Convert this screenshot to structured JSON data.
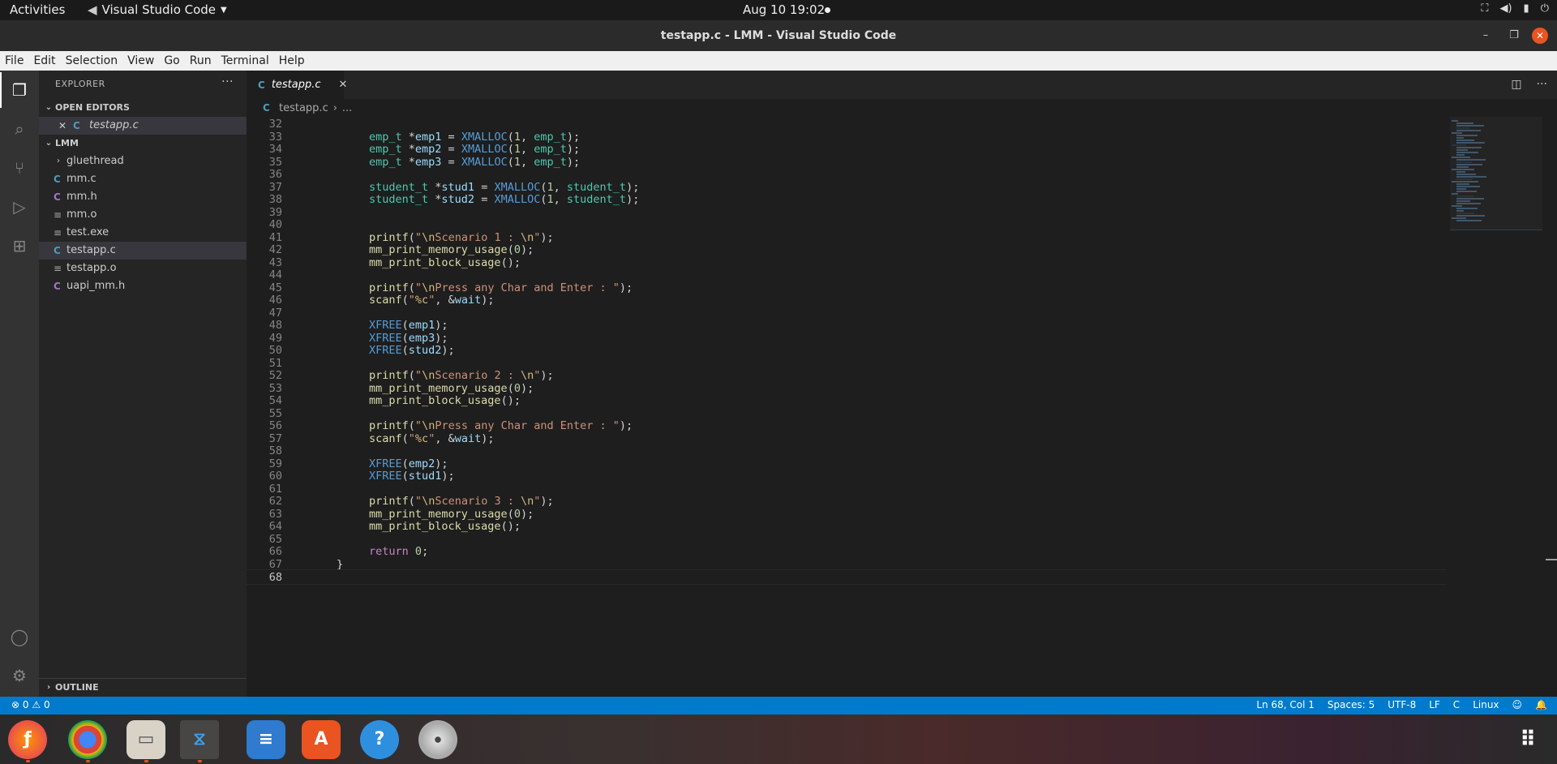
{
  "topbar": {
    "activities": "Activities",
    "app_name": "Visual Studio Code",
    "clock": "Aug 10  19:02"
  },
  "window": {
    "title": "testapp.c - LMM - Visual Studio Code"
  },
  "menubar": [
    "File",
    "Edit",
    "Selection",
    "View",
    "Go",
    "Run",
    "Terminal",
    "Help"
  ],
  "activitybar": [
    "files-icon",
    "search-icon",
    "source-control-icon",
    "run-debug-icon",
    "extensions-icon",
    "account-icon",
    "gear-icon"
  ],
  "sidebar": {
    "title": "EXPLORER",
    "open_editors_label": "OPEN EDITORS",
    "open_editor_file": "testapp.c",
    "folder_label": "LMM",
    "files": [
      {
        "name": "gluethread",
        "kind": "folder"
      },
      {
        "name": "mm.c",
        "kind": "c"
      },
      {
        "name": "mm.h",
        "kind": "h"
      },
      {
        "name": "mm.o",
        "kind": "file"
      },
      {
        "name": "test.exe",
        "kind": "file"
      },
      {
        "name": "testapp.c",
        "kind": "c",
        "selected": true
      },
      {
        "name": "testapp.o",
        "kind": "file"
      },
      {
        "name": "uapi_mm.h",
        "kind": "h"
      }
    ],
    "outline_label": "OUTLINE"
  },
  "editor": {
    "tab_label": "testapp.c",
    "breadcrumb_file": "testapp.c",
    "breadcrumb_rest": "...",
    "current_line": 68,
    "lines": [
      {
        "n": 32,
        "code": ""
      },
      {
        "n": 33,
        "code": "    emp_t *emp1 = XMALLOC(1, emp_t);"
      },
      {
        "n": 34,
        "code": "    emp_t *emp2 = XMALLOC(1, emp_t);"
      },
      {
        "n": 35,
        "code": "    emp_t *emp3 = XMALLOC(1, emp_t);"
      },
      {
        "n": 36,
        "code": ""
      },
      {
        "n": 37,
        "code": "    student_t *stud1 = XMALLOC(1, student_t);"
      },
      {
        "n": 38,
        "code": "    student_t *stud2 = XMALLOC(1, student_t);"
      },
      {
        "n": 39,
        "code": ""
      },
      {
        "n": 40,
        "code": ""
      },
      {
        "n": 41,
        "code": "    printf(\"\\nScenario 1 : \\n\");"
      },
      {
        "n": 42,
        "code": "    mm_print_memory_usage(0);"
      },
      {
        "n": 43,
        "code": "    mm_print_block_usage();"
      },
      {
        "n": 44,
        "code": ""
      },
      {
        "n": 45,
        "code": "    printf(\"\\nPress any Char and Enter : \");"
      },
      {
        "n": 46,
        "code": "    scanf(\"%c\", &wait);"
      },
      {
        "n": 47,
        "code": ""
      },
      {
        "n": 48,
        "code": "    XFREE(emp1);"
      },
      {
        "n": 49,
        "code": "    XFREE(emp3);"
      },
      {
        "n": 50,
        "code": "    XFREE(stud2);"
      },
      {
        "n": 51,
        "code": ""
      },
      {
        "n": 52,
        "code": "    printf(\"\\nScenario 2 : \\n\");"
      },
      {
        "n": 53,
        "code": "    mm_print_memory_usage(0);"
      },
      {
        "n": 54,
        "code": "    mm_print_block_usage();"
      },
      {
        "n": 55,
        "code": ""
      },
      {
        "n": 56,
        "code": "    printf(\"\\nPress any Char and Enter : \");"
      },
      {
        "n": 57,
        "code": "    scanf(\"%c\", &wait);"
      },
      {
        "n": 58,
        "code": ""
      },
      {
        "n": 59,
        "code": "    XFREE(emp2);"
      },
      {
        "n": 60,
        "code": "    XFREE(stud1);"
      },
      {
        "n": 61,
        "code": ""
      },
      {
        "n": 62,
        "code": "    printf(\"\\nScenario 3 : \\n\");"
      },
      {
        "n": 63,
        "code": "    mm_print_memory_usage(0);"
      },
      {
        "n": 64,
        "code": "    mm_print_block_usage();"
      },
      {
        "n": 65,
        "code": ""
      },
      {
        "n": 66,
        "code": "    return 0;"
      },
      {
        "n": 67,
        "code": "}"
      },
      {
        "n": 68,
        "code": ""
      }
    ]
  },
  "statusbar": {
    "errors": "0",
    "warnings": "0",
    "position": "Ln 68, Col 1",
    "spaces": "Spaces: 5",
    "encoding": "UTF-8",
    "eol": "LF",
    "language": "C",
    "platform": "Linux"
  },
  "dock": [
    "firefox-icon",
    "chrome-icon",
    "files-icon",
    "vscode-icon",
    "writer-icon",
    "software-icon",
    "help-icon",
    "disc-icon",
    "app-grid-icon"
  ],
  "colors": {
    "accent": "#007acc",
    "ubuntu_orange": "#e95420"
  }
}
